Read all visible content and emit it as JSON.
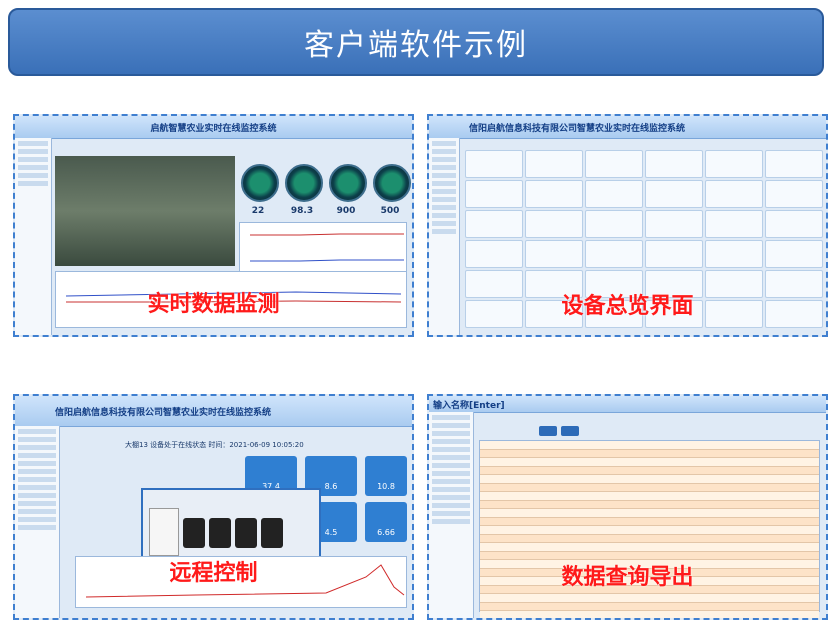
{
  "banner": {
    "title": "客户端软件示例"
  },
  "panels": [
    {
      "caption": "实时数据监测",
      "window_title": "启航智慧农业实时在线监控系统",
      "gauges": [
        {
          "value": "22"
        },
        {
          "value": "98.3"
        },
        {
          "value": "900"
        },
        {
          "value": "500"
        }
      ]
    },
    {
      "caption": "设备总览界面",
      "window_title": "信阳启航信息科技有限公司智慧农业实时在线监控系统"
    },
    {
      "caption": "远程控制",
      "window_title": "信阳启航信息科技有限公司智慧农业实时在线监控系统",
      "status_line": "大棚13  设备处于在线状态  时间：2021-06-09 10:05:20",
      "tiles": [
        {
          "value": "37.4"
        },
        {
          "value": "8.6"
        },
        {
          "value": "10.8"
        },
        {
          "value": "4.5"
        },
        {
          "value": "6.66"
        }
      ]
    },
    {
      "caption": "数据查询导出",
      "window_title": "输入名称[Enter]"
    }
  ],
  "colors": {
    "banner": "#3a70b8",
    "caption": "#ff1a1a",
    "panel_border": "#3f7fd0"
  }
}
